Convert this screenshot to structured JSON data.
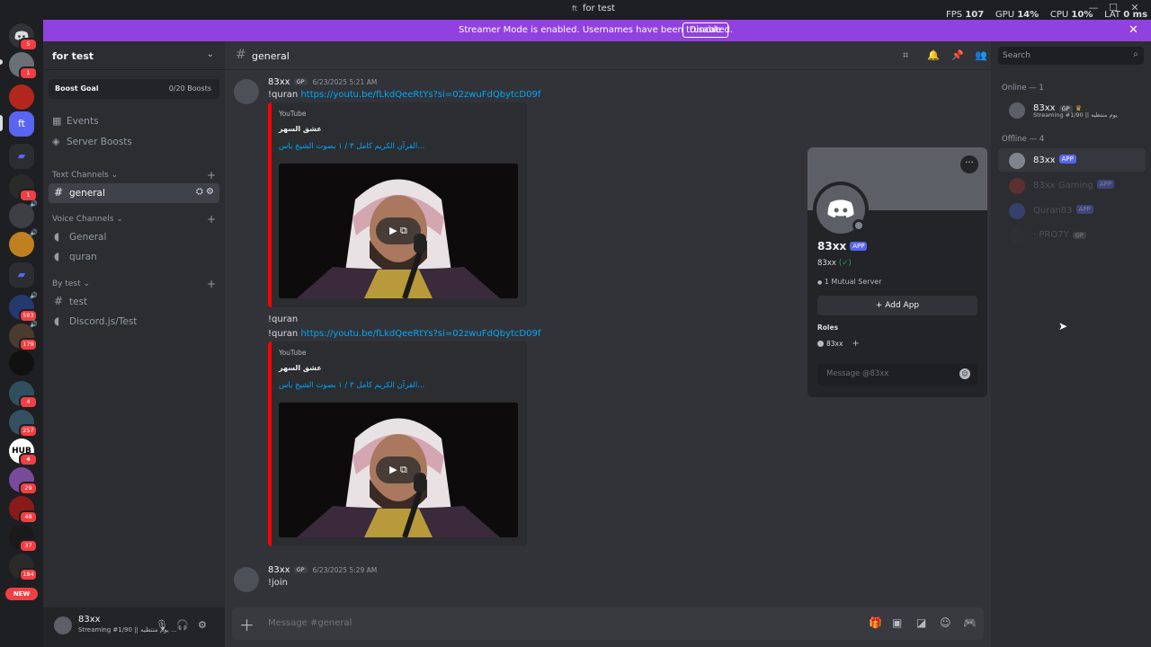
{
  "window": {
    "title": "for test",
    "title_icon": "ft",
    "stats": {
      "fps_label": "FPS",
      "fps": "107",
      "gpu_label": "GPU",
      "gpu": "14%",
      "cpu_label": "CPU",
      "cpu": "10%",
      "lat_label": "LAT",
      "lat": "0 ms"
    }
  },
  "banner": {
    "message": "Streamer Mode is enabled. Usernames have been truncated.",
    "disable_label": "Disable",
    "color": "#9141e0"
  },
  "rail": {
    "servers": [
      {
        "name": "home",
        "badge": "5"
      },
      {
        "name": "server-2",
        "badge": "1"
      },
      {
        "name": "server-3",
        "badge": ""
      },
      {
        "name": "ft",
        "badge": ""
      },
      {
        "name": "folder-1",
        "badge": ""
      },
      {
        "name": "server-gp",
        "badge": "1"
      },
      {
        "name": "server-6",
        "badge": ""
      },
      {
        "name": "server-7",
        "badge": ""
      },
      {
        "name": "folder-2",
        "badge": ""
      },
      {
        "name": "server-9",
        "badge": "593"
      },
      {
        "name": "server-10",
        "badge": "179"
      },
      {
        "name": "server-11",
        "badge": ""
      },
      {
        "name": "server-12",
        "badge": "4"
      },
      {
        "name": "server-13",
        "badge": "257"
      },
      {
        "name": "server-hub",
        "badge": "4"
      },
      {
        "name": "server-15",
        "badge": "29"
      },
      {
        "name": "server-16",
        "badge": "48"
      },
      {
        "name": "server-17",
        "badge": "37"
      },
      {
        "name": "server-18",
        "badge": "184"
      }
    ],
    "ft_label": "ft",
    "hub_label": "HUB",
    "new_label": "NEW"
  },
  "sidebar": {
    "server_name": "for test",
    "boost_goal": "Boost Goal",
    "boost_count": "0/20 Boosts",
    "events": "Events",
    "server_boosts": "Server Boosts",
    "categories": [
      {
        "name": "Text Channels",
        "channels": [
          "general"
        ]
      },
      {
        "name": "Voice Channels",
        "channels": [
          "General",
          "quran"
        ]
      },
      {
        "name": "By test",
        "channels": [
          "test",
          "Discord.js/Test"
        ]
      }
    ]
  },
  "user_panel": {
    "username": "83xx",
    "status": "Streaming #1/90 || يوم منتظيه ..."
  },
  "chat": {
    "channel": "general",
    "messages": [
      {
        "author": "83xx",
        "tag": "GP",
        "time": "6/23/2025 5:21 AM",
        "text": "!quran",
        "link": "https://youtu.be/fLkdQeeRtYs?si=02zwuFdQbytcD09f",
        "embed": {
          "provider": "YouTube",
          "author": "عشق السهر",
          "title": "القرآن الكريم كامل ٣ / ١ بصوت الشيخ ياس..."
        }
      },
      {
        "text": "!quran"
      },
      {
        "text": "!quran",
        "link": "https://youtu.be/fLkdQeeRtYs?si=02zwuFdQbytcD09f",
        "embed": {
          "provider": "YouTube",
          "author": "عشق السهر",
          "title": "القرآن الكريم كامل ٣ / ١ بصوت الشيخ ياس..."
        }
      },
      {
        "author": "83xx",
        "tag": "GP",
        "time": "6/23/2025 5:29 AM",
        "text": "!join"
      }
    ],
    "composer_placeholder": "Message #general"
  },
  "popout": {
    "name": "83xx",
    "app_badge": "APP",
    "username": "83xx",
    "check": "(✓)",
    "mutual": "1 Mutual Server",
    "add_app": "Add App",
    "roles_label": "Roles",
    "role": "83xx",
    "message_placeholder": "Message @83xx"
  },
  "members": {
    "search_placeholder": "Search",
    "online_header": "Online — 1",
    "offline_header": "Offline — 4",
    "online": [
      {
        "name": "83xx",
        "tag": "GP",
        "status": "Streaming #1/90 || يوم منتظيه"
      }
    ],
    "offline": [
      {
        "name": "83xx",
        "badge": "APP"
      },
      {
        "name": "83xx Gaming",
        "badge": "APP"
      },
      {
        "name": "Quran83",
        "badge": "APP"
      },
      {
        "name": "· PRO7Y",
        "tag": "GP"
      }
    ]
  }
}
